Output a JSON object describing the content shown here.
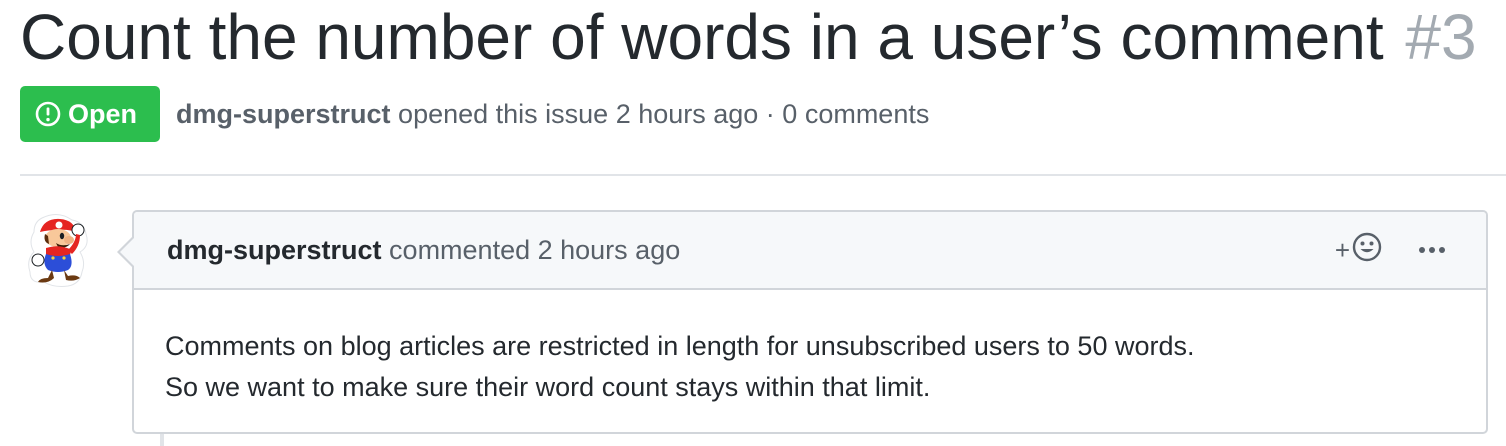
{
  "issue": {
    "title": "Count the number of words in a user’s comment",
    "number": "#3",
    "state_label": "Open",
    "author": "dmg-superstruct",
    "opened_text": "opened this issue 2 hours ago · 0 comments"
  },
  "comment": {
    "author": "dmg-superstruct",
    "time_text": "commented 2 hours ago",
    "reaction_plus": "+",
    "body_lines": [
      "Comments on blog articles are restricted in length for unsubscribed users to 50 words.",
      "So we want to make sure their word count stays within that limit."
    ]
  },
  "icons": {
    "state": "issue-opened-icon",
    "reaction": "smiley-icon",
    "more": "kebab-horizontal-icon",
    "avatar": "mario-avatar"
  },
  "colors": {
    "open_green": "#2cbe4e",
    "text_primary": "#24292e",
    "text_muted": "#586069",
    "issue_number": "#a3aab1",
    "border": "#d1d5da",
    "header_bg": "#f6f8fa"
  }
}
